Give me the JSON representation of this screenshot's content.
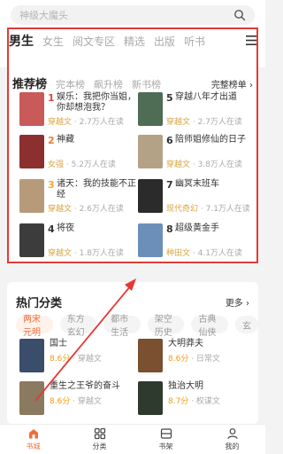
{
  "search": {
    "placeholder": "神级大魔头",
    "icon": "search-icon"
  },
  "tabs": [
    {
      "label": "男生",
      "active": true
    },
    {
      "label": "女生"
    },
    {
      "label": "阅文专区"
    },
    {
      "label": "精选"
    },
    {
      "label": "出版"
    },
    {
      "label": "听书"
    }
  ],
  "rank": {
    "title": "推荐榜",
    "subtabs": [
      "完本榜",
      "飙升榜",
      "新书榜"
    ],
    "more": "完整榜单 ›",
    "books": [
      {
        "num": "1",
        "name": "娱乐：我把你当姐，你却想泡我？",
        "genre": "穿越文",
        "reads": "· 2.7万人在读",
        "cover": "#c85a5a"
      },
      {
        "num": "2",
        "name": "神藏",
        "genre": "女强",
        "reads": "· 5.2万人在读",
        "cover": "#8c2f2f"
      },
      {
        "num": "3",
        "name": "诸天：我的技能不正经",
        "genre": "穿越文",
        "reads": "· 2.6万人在读",
        "cover": "#b69a7a"
      },
      {
        "num": "4",
        "name": "将夜",
        "genre": "穿越文",
        "reads": "· 1.8万人在读",
        "cover": "#3c3c3c"
      },
      {
        "num": "5",
        "name": "穿越八年才出道",
        "genre": "穿越文",
        "reads": "· 2.7万人在读",
        "cover": "#4f6c54"
      },
      {
        "num": "6",
        "name": "陪师姐修仙的日子",
        "genre": "穿越文",
        "reads": "· 3.8万人在读",
        "cover": "#b3a286"
      },
      {
        "num": "7",
        "name": "幽冥末班车",
        "genre": "现代奇幻",
        "reads": "· 7.1万人在读",
        "cover": "#2b2b2b"
      },
      {
        "num": "8",
        "name": "超级黄金手",
        "genre": "种田文",
        "reads": "· 4.1万人在读",
        "cover": "#6b8fb8"
      }
    ]
  },
  "hot": {
    "title": "热门分类",
    "more": "更多 ›",
    "chips": [
      {
        "label": "两宋元明",
        "active": true
      },
      {
        "label": "东方玄幻"
      },
      {
        "label": "都市生活"
      },
      {
        "label": "架空历史"
      },
      {
        "label": "古典仙侠"
      },
      {
        "label": "玄"
      }
    ],
    "books": [
      {
        "name": "国士",
        "score": "8.6分",
        "genre": "穿越文",
        "cover": "#3a4e6b"
      },
      {
        "name": "大明莽夫",
        "score": "8.6分",
        "genre": "日常文",
        "cover": "#7a5030"
      },
      {
        "name": "重生之王爷的奋斗",
        "score": "8.6分",
        "genre": "穿越文",
        "cover": "#8a7a60"
      },
      {
        "name": "独治大明",
        "score": "8.7分",
        "genre": "权谋文",
        "cover": "#2e3a2e"
      }
    ]
  },
  "nav": [
    {
      "label": "书城",
      "icon": "bookstore-icon",
      "active": true
    },
    {
      "label": "分类",
      "icon": "category-icon"
    },
    {
      "label": "书架",
      "icon": "bookshelf-icon"
    },
    {
      "label": "我的",
      "icon": "profile-icon"
    }
  ],
  "colors": {
    "accent": "#ef6d3c",
    "highlight": "#e53935",
    "gold": "#d9a441"
  }
}
